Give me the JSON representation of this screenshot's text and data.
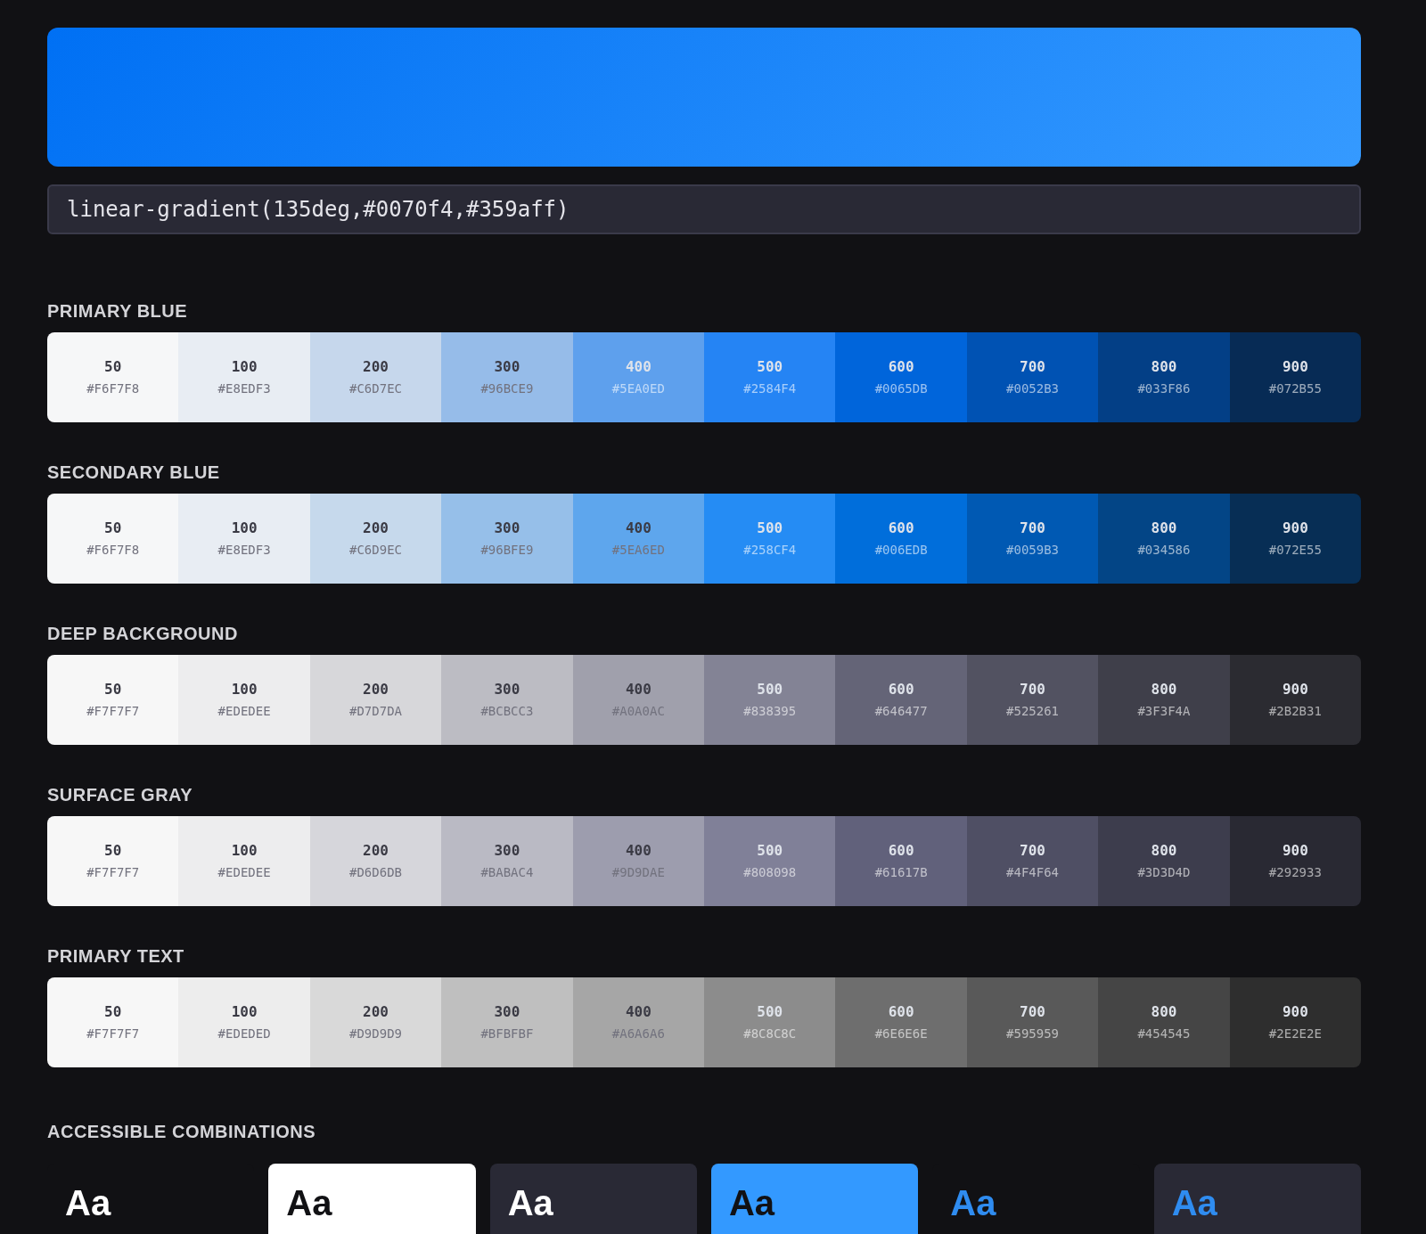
{
  "gradient": {
    "css": "linear-gradient(135deg,#0070f4,#359aff)"
  },
  "palettes": [
    {
      "title": "PRIMARY BLUE",
      "swatches": [
        {
          "label": "50",
          "hex": "#F6F7F8",
          "color": "#f6f7f8"
        },
        {
          "label": "100",
          "hex": "#E8EDF3",
          "color": "#e8edf3"
        },
        {
          "label": "200",
          "hex": "#C6D7EC",
          "color": "#c6d7ec"
        },
        {
          "label": "300",
          "hex": "#96BCE9",
          "color": "#96bce9"
        },
        {
          "label": "400",
          "hex": "#5EA0ED",
          "color": "#5ea0ed"
        },
        {
          "label": "500",
          "hex": "#2584F4",
          "color": "#2584f4"
        },
        {
          "label": "600",
          "hex": "#0065DB",
          "color": "#0065db"
        },
        {
          "label": "700",
          "hex": "#0052B3",
          "color": "#0052b3"
        },
        {
          "label": "800",
          "hex": "#033F86",
          "color": "#033f86"
        },
        {
          "label": "900",
          "hex": "#072B55",
          "color": "#072b55"
        }
      ]
    },
    {
      "title": "SECONDARY BLUE",
      "swatches": [
        {
          "label": "50",
          "hex": "#F6F7F8",
          "color": "#f6f7f8"
        },
        {
          "label": "100",
          "hex": "#E8EDF3",
          "color": "#e8edf3"
        },
        {
          "label": "200",
          "hex": "#C6D9EC",
          "color": "#c6d9ec"
        },
        {
          "label": "300",
          "hex": "#96BFE9",
          "color": "#96bfe9"
        },
        {
          "label": "400",
          "hex": "#5EA6ED",
          "color": "#5ea6ed"
        },
        {
          "label": "500",
          "hex": "#258CF4",
          "color": "#258cf4"
        },
        {
          "label": "600",
          "hex": "#006EDB",
          "color": "#006edb"
        },
        {
          "label": "700",
          "hex": "#0059B3",
          "color": "#0059b3"
        },
        {
          "label": "800",
          "hex": "#034586",
          "color": "#034586"
        },
        {
          "label": "900",
          "hex": "#072E55",
          "color": "#072e55"
        }
      ]
    },
    {
      "title": "DEEP BACKGROUND",
      "swatches": [
        {
          "label": "50",
          "hex": "#F7F7F7",
          "color": "#f7f7f7"
        },
        {
          "label": "100",
          "hex": "#EDEDEE",
          "color": "#ededee"
        },
        {
          "label": "200",
          "hex": "#D7D7DA",
          "color": "#d7d7da"
        },
        {
          "label": "300",
          "hex": "#BCBCC3",
          "color": "#bcbcc3"
        },
        {
          "label": "400",
          "hex": "#A0A0AC",
          "color": "#a0a0ac"
        },
        {
          "label": "500",
          "hex": "#838395",
          "color": "#838395"
        },
        {
          "label": "600",
          "hex": "#646477",
          "color": "#646477"
        },
        {
          "label": "700",
          "hex": "#525261",
          "color": "#525261"
        },
        {
          "label": "800",
          "hex": "#3F3F4A",
          "color": "#3f3f4a"
        },
        {
          "label": "900",
          "hex": "#2B2B31",
          "color": "#2b2b31"
        }
      ]
    },
    {
      "title": "SURFACE GRAY",
      "swatches": [
        {
          "label": "50",
          "hex": "#F7F7F7",
          "color": "#f7f7f7"
        },
        {
          "label": "100",
          "hex": "#EDEDEE",
          "color": "#ededee"
        },
        {
          "label": "200",
          "hex": "#D6D6DB",
          "color": "#d6d6db"
        },
        {
          "label": "300",
          "hex": "#BABAC4",
          "color": "#babac4"
        },
        {
          "label": "400",
          "hex": "#9D9DAE",
          "color": "#9d9dae"
        },
        {
          "label": "500",
          "hex": "#808098",
          "color": "#808098"
        },
        {
          "label": "600",
          "hex": "#61617B",
          "color": "#61617b"
        },
        {
          "label": "700",
          "hex": "#4F4F64",
          "color": "#4f4f64"
        },
        {
          "label": "800",
          "hex": "#3D3D4D",
          "color": "#3d3d4d"
        },
        {
          "label": "900",
          "hex": "#292933",
          "color": "#292933"
        }
      ]
    },
    {
      "title": "PRIMARY TEXT",
      "swatches": [
        {
          "label": "50",
          "hex": "#F7F7F7",
          "color": "#f7f7f7"
        },
        {
          "label": "100",
          "hex": "#EDEDED",
          "color": "#ededed"
        },
        {
          "label": "200",
          "hex": "#D9D9D9",
          "color": "#d9d9d9"
        },
        {
          "label": "300",
          "hex": "#BFBFBF",
          "color": "#bfbfbf"
        },
        {
          "label": "400",
          "hex": "#A6A6A6",
          "color": "#a6a6a6"
        },
        {
          "label": "500",
          "hex": "#8C8C8C",
          "color": "#8c8c8c"
        },
        {
          "label": "600",
          "hex": "#6E6E6E",
          "color": "#6e6e6e"
        },
        {
          "label": "700",
          "hex": "#595959",
          "color": "#595959"
        },
        {
          "label": "800",
          "hex": "#454545",
          "color": "#454545"
        },
        {
          "label": "900",
          "hex": "#2E2E2E",
          "color": "#2e2e2e"
        }
      ]
    }
  ],
  "combinations": {
    "title": "ACCESSIBLE COMBINATIONS",
    "items": [
      {
        "sample": "Aa",
        "color": "#ffffff",
        "kind": "plain"
      },
      {
        "sample": "Aa",
        "color": "#111114",
        "kind": "white"
      },
      {
        "sample": "Aa",
        "color": "#ffffff",
        "kind": "surface"
      },
      {
        "sample": "Aa",
        "color": "#111114",
        "kind": "blue"
      },
      {
        "sample": "Aa",
        "color": "#2f8cf0",
        "kind": "plain"
      },
      {
        "sample": "Aa",
        "color": "#2f8cf0",
        "kind": "surface"
      }
    ]
  }
}
